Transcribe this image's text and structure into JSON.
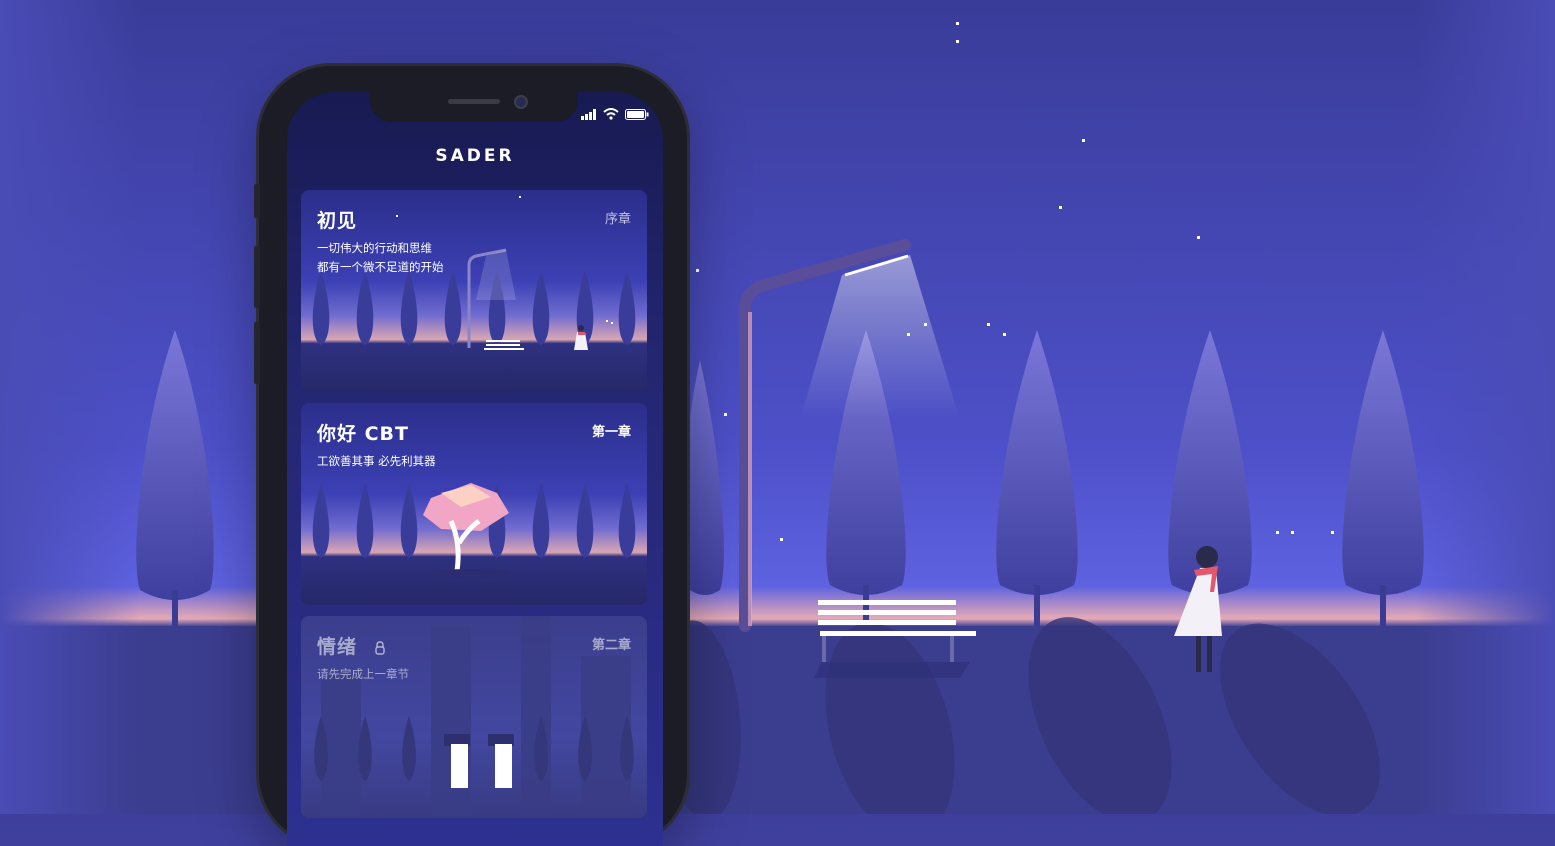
{
  "app": {
    "title": "SADER"
  },
  "status_bar": {
    "signal_icon": "signal-icon",
    "wifi_icon": "wifi-icon",
    "battery_icon": "battery-icon"
  },
  "chapters": [
    {
      "title": "初见",
      "chapter": "序章",
      "lines": [
        "一切伟大的行动和思维",
        "都有一个微不足道的开始"
      ],
      "locked": false
    },
    {
      "title": "你好 CBT",
      "chapter": "第一章",
      "lines": [
        "工欲善其事 必先利其器"
      ],
      "locked": false
    },
    {
      "title": "情绪",
      "chapter": "第二章",
      "lines": [
        "请先完成上一章节"
      ],
      "locked": true,
      "lock_icon": "lock-icon"
    }
  ],
  "colors": {
    "background": "#4a4cb6",
    "horizon_glow": "#e8a8b4",
    "scarf": "#e4566b"
  }
}
